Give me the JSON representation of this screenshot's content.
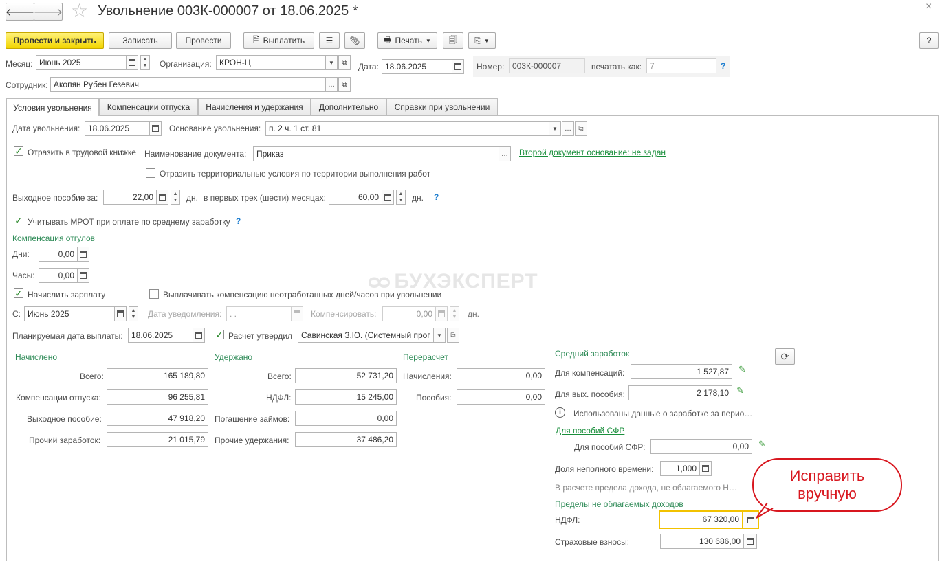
{
  "window": {
    "title": "Увольнение 003К-000007 от 18.06.2025 *",
    "help_label": "?"
  },
  "toolbar": {
    "post_and_close": "Провести и закрыть",
    "save": "Записать",
    "post": "Провести",
    "pay": "Выплатить",
    "print": "Печать"
  },
  "header": {
    "month_label": "Месяц:",
    "month_value": "Июнь 2025",
    "org_label": "Организация:",
    "org_value": "КРОН-Ц",
    "date_label": "Дата:",
    "date_value": "18.06.2025",
    "number_label": "Номер:",
    "number_value": "003К-000007",
    "print_as_label": "печатать как:",
    "print_as_value": "7",
    "employee_label": "Сотрудник:",
    "employee_value": "Акопян Рубен Гезевич"
  },
  "tabs": [
    {
      "label": "Условия увольнения"
    },
    {
      "label": "Компенсации отпуска"
    },
    {
      "label": "Начисления и удержания"
    },
    {
      "label": "Дополнительно"
    },
    {
      "label": "Справки при увольнении"
    }
  ],
  "conditions": {
    "dismissal_date_label": "Дата увольнения:",
    "dismissal_date_value": "18.06.2025",
    "basis_label": "Основание увольнения:",
    "basis_value": "п. 2 ч. 1 ст. 81",
    "work_book_label": "Отразить в трудовой книжке",
    "doc_name_label": "Наименование документа:",
    "doc_name_value": "Приказ",
    "second_doc_link": "Второй документ основание: не задан",
    "territorial_label": "Отразить территориальные условия по территории выполнения работ",
    "severance_label": "Выходное пособие за:",
    "severance_days": "22,00",
    "days_unit": "дн.",
    "first_months_label": "в первых трех (шести) месяцах:",
    "first_months_days": "60,00",
    "mrot_label": "Учитывать МРОТ при оплате по среднему заработку",
    "vacation_comp_header": "Компенсация отгулов",
    "days_label": "Дни:",
    "days_value": "0,00",
    "hours_label": "Часы:",
    "hours_value": "0,00",
    "accrue_salary_label": "Начислить зарплату",
    "pay_unworked_label": "Выплачивать компенсацию неотработанных дней/часов при увольнении",
    "from_label": "С:",
    "from_value": "Июнь 2025",
    "notice_date_label": "Дата уведомления:",
    "notice_date_value": " .  .",
    "compensate_label": "Компенсировать:",
    "compensate_value": "0,00",
    "planned_pay_label": "Планируемая дата выплаты:",
    "planned_pay_value": "18.06.2025",
    "approved_label": "Расчет утвердил",
    "approved_value": "Савинская З.Ю. (Системный прог"
  },
  "accrued": {
    "header": "Начислено",
    "total_label": "Всего:",
    "total_value": "165 189,80",
    "vacation_label": "Компенсации отпуска:",
    "vacation_value": "96 255,81",
    "severance_label": "Выходное пособие:",
    "severance_value": "47 918,20",
    "other_label": "Прочий заработок:",
    "other_value": "21 015,79"
  },
  "withheld": {
    "header": "Удержано",
    "total_label": "Всего:",
    "total_value": "52 731,20",
    "ndfl_label": "НДФЛ:",
    "ndfl_value": "15 245,00",
    "loans_label": "Погашение займов:",
    "loans_value": "0,00",
    "other_label": "Прочие удержания:",
    "other_value": "37 486,20"
  },
  "recalc": {
    "header": "Перерасчет",
    "accruals_label": "Начисления:",
    "accruals_value": "0,00",
    "benefits_label": "Пособия:",
    "benefits_value": "0,00"
  },
  "average": {
    "header": "Средний заработок",
    "comp_label": "Для компенсаций:",
    "comp_value": "1 527,87",
    "severance_label": "Для вых. пособия:",
    "severance_value": "2 178,10",
    "info_text": "Использованы данные о заработке за перио…",
    "sfr_link": "Для пособий СФР",
    "sfr_label": "Для пособий СФР:",
    "sfr_value": "0,00",
    "part_time_label": "Доля неполного времени:",
    "part_time_value": "1,000",
    "limit_note": "В расчете предела дохода, не облагаемого Н…"
  },
  "limits": {
    "header": "Пределы не облагаемых доходов",
    "ndfl_label": "НДФЛ:",
    "ndfl_value": "67 320,00",
    "insurance_label": "Страховые взносы:",
    "insurance_value": "130 686,00"
  },
  "annotation": {
    "callout_text": "Исправить вручную"
  },
  "watermark": {
    "text": "БУХЭКСПЕРТ"
  }
}
